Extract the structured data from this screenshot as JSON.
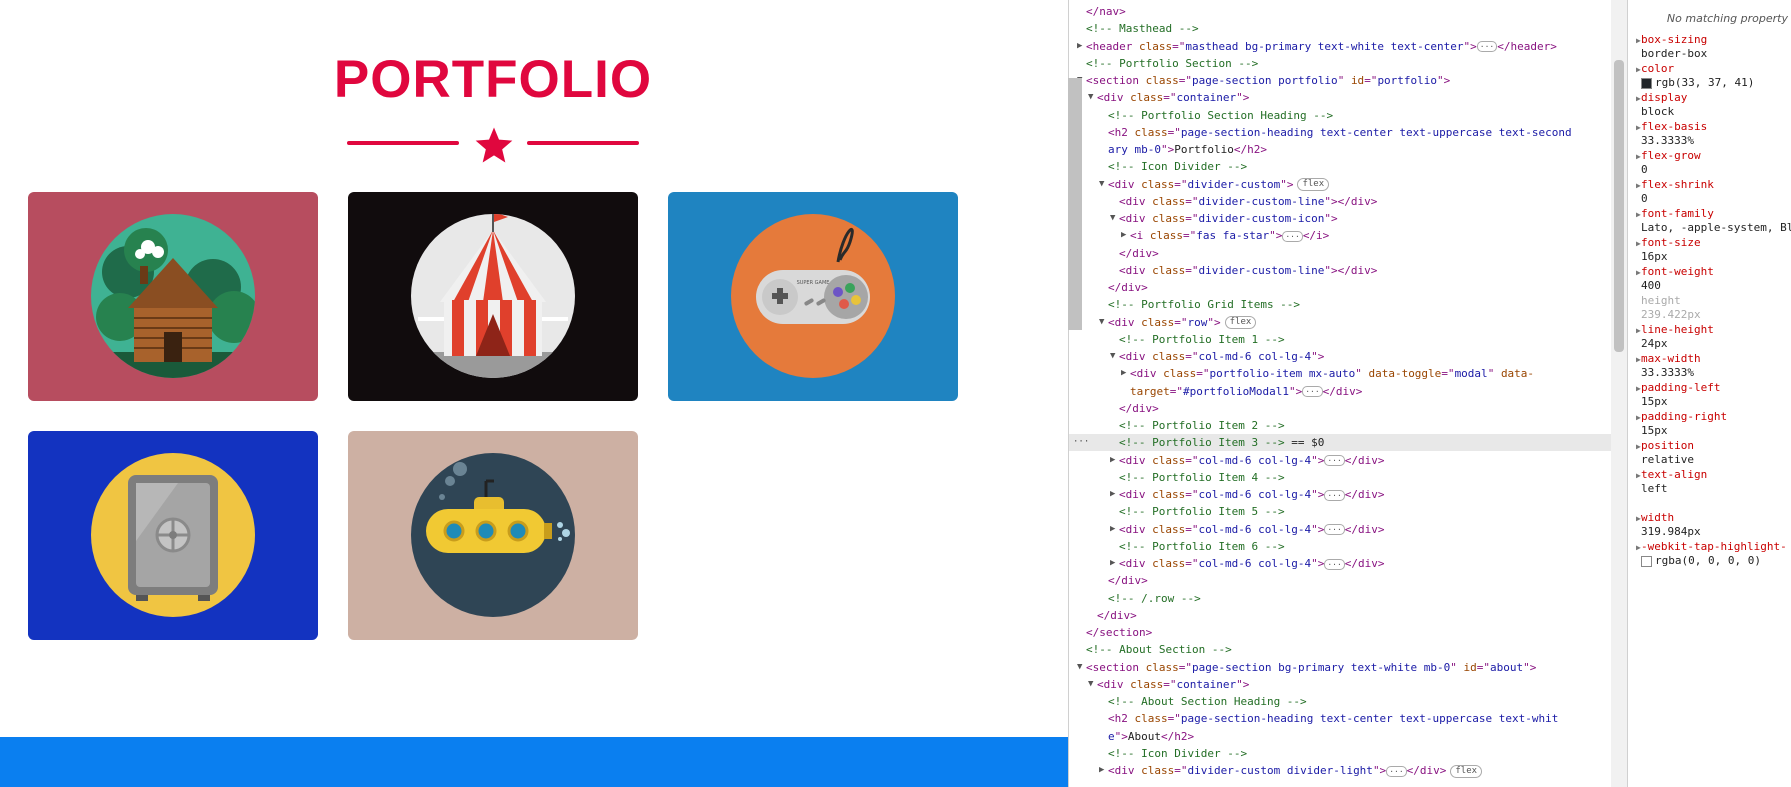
{
  "portfolio": {
    "title": "PORTFOLIO",
    "accent_color": "#e0073e",
    "items": [
      {
        "name": "Cabin",
        "bg": "#b74d5f",
        "icon": "cabin-icon"
      },
      {
        "name": "Circus Tent",
        "bg": "#110c0d",
        "icon": "circus-tent-icon"
      },
      {
        "name": "Game Controller",
        "bg": "#1f84c1",
        "icon": "game-controller-icon"
      },
      {
        "name": "Safe",
        "bg": "#1333c0",
        "icon": "safe-icon"
      },
      {
        "name": "Submarine",
        "bg": "#cdb0a3",
        "icon": "submarine-icon"
      }
    ],
    "controller_brand": "SUPER GAME"
  },
  "bottom_bar_color": "#0a7ff0",
  "elements": [
    {
      "i": 0,
      "tri": "",
      "parts": [
        [
          "t",
          "</nav>"
        ]
      ]
    },
    {
      "i": 0,
      "tri": "",
      "parts": [
        [
          "c",
          "<!-- Masthead -->"
        ]
      ]
    },
    {
      "i": 0,
      "tri": "▶",
      "parts": [
        [
          "t",
          "<header "
        ],
        [
          "a",
          "class"
        ],
        [
          "t",
          "=\""
        ],
        [
          "v",
          "masthead bg-primary text-white text-center"
        ],
        [
          "t",
          "\">"
        ],
        [
          "d",
          "···"
        ],
        [
          "t",
          "</header>"
        ]
      ]
    },
    {
      "i": 0,
      "tri": "",
      "parts": [
        [
          "c",
          "<!-- Portfolio Section -->"
        ]
      ]
    },
    {
      "i": 0,
      "tri": "▼",
      "parts": [
        [
          "t",
          "<section "
        ],
        [
          "a",
          "class"
        ],
        [
          "t",
          "=\""
        ],
        [
          "v",
          "page-section portfolio"
        ],
        [
          "t",
          "\" "
        ],
        [
          "a",
          "id"
        ],
        [
          "t",
          "=\""
        ],
        [
          "v",
          "portfolio"
        ],
        [
          "t",
          "\">"
        ]
      ]
    },
    {
      "i": 1,
      "tri": "▼",
      "parts": [
        [
          "t",
          "<div "
        ],
        [
          "a",
          "class"
        ],
        [
          "t",
          "=\""
        ],
        [
          "v",
          "container"
        ],
        [
          "t",
          "\">"
        ]
      ]
    },
    {
      "i": 2,
      "tri": "",
      "parts": [
        [
          "c",
          "<!-- Portfolio Section Heading -->"
        ]
      ]
    },
    {
      "i": 2,
      "tri": "",
      "parts": [
        [
          "t",
          "<h2 "
        ],
        [
          "a",
          "class"
        ],
        [
          "t",
          "=\""
        ],
        [
          "v",
          "page-section-heading text-center text-uppercase text-second"
        ]
      ]
    },
    {
      "i": 2,
      "tri": "",
      "parts": [
        [
          "v",
          "ary mb-0"
        ],
        [
          "t",
          "\">"
        ],
        [
          "x",
          "Portfolio"
        ],
        [
          "t",
          "</h2>"
        ]
      ]
    },
    {
      "i": 2,
      "tri": "",
      "parts": [
        [
          "c",
          "<!-- Icon Divider -->"
        ]
      ]
    },
    {
      "i": 2,
      "tri": "▼",
      "parts": [
        [
          "t",
          "<div "
        ],
        [
          "a",
          "class"
        ],
        [
          "t",
          "=\""
        ],
        [
          "v",
          "divider-custom"
        ],
        [
          "t",
          "\">"
        ],
        [
          "p",
          "flex"
        ]
      ]
    },
    {
      "i": 3,
      "tri": "",
      "parts": [
        [
          "t",
          "<div "
        ],
        [
          "a",
          "class"
        ],
        [
          "t",
          "=\""
        ],
        [
          "v",
          "divider-custom-line"
        ],
        [
          "t",
          "\"></div>"
        ]
      ]
    },
    {
      "i": 3,
      "tri": "▼",
      "parts": [
        [
          "t",
          "<div "
        ],
        [
          "a",
          "class"
        ],
        [
          "t",
          "=\""
        ],
        [
          "v",
          "divider-custom-icon"
        ],
        [
          "t",
          "\">"
        ]
      ]
    },
    {
      "i": 4,
      "tri": "▶",
      "parts": [
        [
          "t",
          "<i "
        ],
        [
          "a",
          "class"
        ],
        [
          "t",
          "=\""
        ],
        [
          "v",
          "fas fa-star"
        ],
        [
          "t",
          "\">"
        ],
        [
          "d",
          "···"
        ],
        [
          "t",
          "</i>"
        ]
      ]
    },
    {
      "i": 3,
      "tri": "",
      "parts": [
        [
          "t",
          "</div>"
        ]
      ]
    },
    {
      "i": 3,
      "tri": "",
      "parts": [
        [
          "t",
          "<div "
        ],
        [
          "a",
          "class"
        ],
        [
          "t",
          "=\""
        ],
        [
          "v",
          "divider-custom-line"
        ],
        [
          "t",
          "\"></div>"
        ]
      ]
    },
    {
      "i": 2,
      "tri": "",
      "parts": [
        [
          "t",
          "</div>"
        ]
      ]
    },
    {
      "i": 2,
      "tri": "",
      "parts": [
        [
          "c",
          "<!-- Portfolio Grid Items -->"
        ]
      ]
    },
    {
      "i": 2,
      "tri": "▼",
      "parts": [
        [
          "t",
          "<div "
        ],
        [
          "a",
          "class"
        ],
        [
          "t",
          "=\""
        ],
        [
          "v",
          "row"
        ],
        [
          "t",
          "\">"
        ],
        [
          "p",
          "flex"
        ]
      ]
    },
    {
      "i": 3,
      "tri": "",
      "parts": [
        [
          "c",
          "<!-- Portfolio Item 1 -->"
        ]
      ]
    },
    {
      "i": 3,
      "tri": "▼",
      "parts": [
        [
          "t",
          "<div "
        ],
        [
          "a",
          "class"
        ],
        [
          "t",
          "=\""
        ],
        [
          "v",
          "col-md-6 col-lg-4"
        ],
        [
          "t",
          "\">"
        ]
      ]
    },
    {
      "i": 4,
      "tri": "▶",
      "parts": [
        [
          "t",
          "<div "
        ],
        [
          "a",
          "class"
        ],
        [
          "t",
          "=\""
        ],
        [
          "v",
          "portfolio-item mx-auto"
        ],
        [
          "t",
          "\" "
        ],
        [
          "a",
          "data-toggle"
        ],
        [
          "t",
          "=\""
        ],
        [
          "v",
          "modal"
        ],
        [
          "t",
          "\" "
        ],
        [
          "a",
          "data-"
        ]
      ]
    },
    {
      "i": 4,
      "tri": "",
      "parts": [
        [
          "a",
          "target"
        ],
        [
          "t",
          "=\""
        ],
        [
          "v",
          "#portfolioModal1"
        ],
        [
          "t",
          "\">"
        ],
        [
          "d",
          "···"
        ],
        [
          "t",
          "</div>"
        ]
      ]
    },
    {
      "i": 3,
      "tri": "",
      "parts": [
        [
          "t",
          "</div>"
        ]
      ]
    },
    {
      "i": 3,
      "tri": "",
      "parts": [
        [
          "c",
          "<!-- Portfolio Item 2 -->"
        ]
      ]
    },
    {
      "i": 3,
      "tri": "",
      "sel": true,
      "parts": [
        [
          "c",
          "<!-- Portfolio Item 3 -->"
        ],
        [
          "x",
          " == $0"
        ]
      ]
    },
    {
      "i": 3,
      "tri": "▶",
      "parts": [
        [
          "t",
          "<div "
        ],
        [
          "a",
          "class"
        ],
        [
          "t",
          "=\""
        ],
        [
          "v",
          "col-md-6 col-lg-4"
        ],
        [
          "t",
          "\">"
        ],
        [
          "d",
          "···"
        ],
        [
          "t",
          "</div>"
        ]
      ]
    },
    {
      "i": 3,
      "tri": "",
      "parts": [
        [
          "c",
          "<!-- Portfolio Item 4 -->"
        ]
      ]
    },
    {
      "i": 3,
      "tri": "▶",
      "parts": [
        [
          "t",
          "<div "
        ],
        [
          "a",
          "class"
        ],
        [
          "t",
          "=\""
        ],
        [
          "v",
          "col-md-6 col-lg-4"
        ],
        [
          "t",
          "\">"
        ],
        [
          "d",
          "···"
        ],
        [
          "t",
          "</div>"
        ]
      ]
    },
    {
      "i": 3,
      "tri": "",
      "parts": [
        [
          "c",
          "<!-- Portfolio Item 5 -->"
        ]
      ]
    },
    {
      "i": 3,
      "tri": "▶",
      "parts": [
        [
          "t",
          "<div "
        ],
        [
          "a",
          "class"
        ],
        [
          "t",
          "=\""
        ],
        [
          "v",
          "col-md-6 col-lg-4"
        ],
        [
          "t",
          "\">"
        ],
        [
          "d",
          "···"
        ],
        [
          "t",
          "</div>"
        ]
      ]
    },
    {
      "i": 3,
      "tri": "",
      "parts": [
        [
          "c",
          "<!-- Portfolio Item 6 -->"
        ]
      ]
    },
    {
      "i": 3,
      "tri": "▶",
      "parts": [
        [
          "t",
          "<div "
        ],
        [
          "a",
          "class"
        ],
        [
          "t",
          "=\""
        ],
        [
          "v",
          "col-md-6 col-lg-4"
        ],
        [
          "t",
          "\">"
        ],
        [
          "d",
          "···"
        ],
        [
          "t",
          "</div>"
        ]
      ]
    },
    {
      "i": 2,
      "tri": "",
      "parts": [
        [
          "t",
          "</div>"
        ]
      ]
    },
    {
      "i": 2,
      "tri": "",
      "parts": [
        [
          "c",
          "<!-- /.row -->"
        ]
      ]
    },
    {
      "i": 1,
      "tri": "",
      "parts": [
        [
          "t",
          "</div>"
        ]
      ]
    },
    {
      "i": 0,
      "tri": "",
      "parts": [
        [
          "t",
          "</section>"
        ]
      ]
    },
    {
      "i": 0,
      "tri": "",
      "parts": [
        [
          "c",
          "<!-- About Section -->"
        ]
      ]
    },
    {
      "i": 0,
      "tri": "▼",
      "parts": [
        [
          "t",
          "<section "
        ],
        [
          "a",
          "class"
        ],
        [
          "t",
          "=\""
        ],
        [
          "v",
          "page-section bg-primary text-white mb-0"
        ],
        [
          "t",
          "\" "
        ],
        [
          "a",
          "id"
        ],
        [
          "t",
          "=\""
        ],
        [
          "v",
          "about"
        ],
        [
          "t",
          "\">"
        ]
      ]
    },
    {
      "i": 1,
      "tri": "▼",
      "parts": [
        [
          "t",
          "<div "
        ],
        [
          "a",
          "class"
        ],
        [
          "t",
          "=\""
        ],
        [
          "v",
          "container"
        ],
        [
          "t",
          "\">"
        ]
      ]
    },
    {
      "i": 2,
      "tri": "",
      "parts": [
        [
          "c",
          "<!-- About Section Heading -->"
        ]
      ]
    },
    {
      "i": 2,
      "tri": "",
      "parts": [
        [
          "t",
          "<h2 "
        ],
        [
          "a",
          "class"
        ],
        [
          "t",
          "=\""
        ],
        [
          "v",
          "page-section-heading text-center text-uppercase text-whit"
        ]
      ]
    },
    {
      "i": 2,
      "tri": "",
      "parts": [
        [
          "v",
          "e"
        ],
        [
          "t",
          "\">"
        ],
        [
          "x",
          "About"
        ],
        [
          "t",
          "</h2>"
        ]
      ]
    },
    {
      "i": 2,
      "tri": "",
      "parts": [
        [
          "c",
          "<!-- Icon Divider -->"
        ]
      ]
    },
    {
      "i": 2,
      "tri": "▶",
      "parts": [
        [
          "t",
          "<div "
        ],
        [
          "a",
          "class"
        ],
        [
          "t",
          "=\""
        ],
        [
          "v",
          "divider-custom divider-light"
        ],
        [
          "t",
          "\">"
        ],
        [
          "d",
          "···"
        ],
        [
          "t",
          "</div>"
        ],
        [
          "p",
          "flex"
        ]
      ]
    }
  ],
  "styles": {
    "header": "No matching property",
    "props": [
      {
        "n": "box-sizing",
        "v": "border-box"
      },
      {
        "n": "color",
        "v": "rgb(33, 37, 41)",
        "swatch": "#212529"
      },
      {
        "n": "display",
        "v": "block"
      },
      {
        "n": "flex-basis",
        "v": "33.3333%"
      },
      {
        "n": "flex-grow",
        "v": "0"
      },
      {
        "n": "flex-shrink",
        "v": "0"
      },
      {
        "n": "font-family",
        "v": "Lato, -apple-system, Bl"
      },
      {
        "n": "font-size",
        "v": "16px"
      },
      {
        "n": "font-weight",
        "v": "400"
      },
      {
        "n": "height",
        "v": "239.422px",
        "dim": true
      },
      {
        "n": "line-height",
        "v": "24px"
      },
      {
        "n": "max-width",
        "v": "33.3333%"
      },
      {
        "n": "padding-left",
        "v": "15px"
      },
      {
        "n": "padding-right",
        "v": "15px"
      },
      {
        "n": "position",
        "v": "relative"
      },
      {
        "n": "text-align",
        "v": "left"
      },
      {
        "n": "width",
        "v": "319.984px"
      },
      {
        "n": "-webkit-tap-highlight-c",
        "v": "rgba(0, 0, 0, 0)",
        "swatch": "#ffffff"
      }
    ]
  }
}
